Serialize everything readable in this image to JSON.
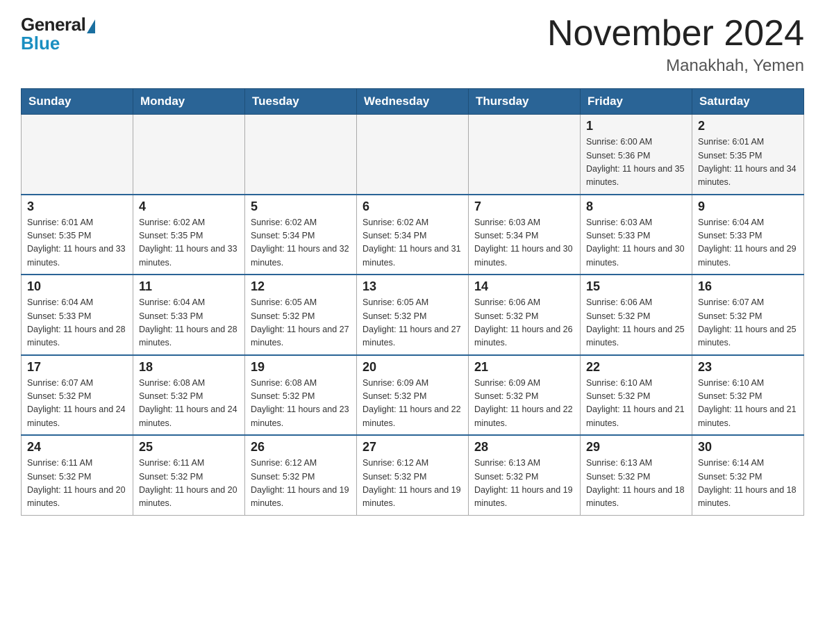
{
  "header": {
    "logo": {
      "general": "General",
      "blue": "Blue"
    },
    "title": "November 2024",
    "subtitle": "Manakhah, Yemen"
  },
  "weekdays": [
    "Sunday",
    "Monday",
    "Tuesday",
    "Wednesday",
    "Thursday",
    "Friday",
    "Saturday"
  ],
  "weeks": [
    [
      {
        "day": "",
        "sunrise": "",
        "sunset": "",
        "daylight": ""
      },
      {
        "day": "",
        "sunrise": "",
        "sunset": "",
        "daylight": ""
      },
      {
        "day": "",
        "sunrise": "",
        "sunset": "",
        "daylight": ""
      },
      {
        "day": "",
        "sunrise": "",
        "sunset": "",
        "daylight": ""
      },
      {
        "day": "",
        "sunrise": "",
        "sunset": "",
        "daylight": ""
      },
      {
        "day": "1",
        "sunrise": "Sunrise: 6:00 AM",
        "sunset": "Sunset: 5:36 PM",
        "daylight": "Daylight: 11 hours and 35 minutes."
      },
      {
        "day": "2",
        "sunrise": "Sunrise: 6:01 AM",
        "sunset": "Sunset: 5:35 PM",
        "daylight": "Daylight: 11 hours and 34 minutes."
      }
    ],
    [
      {
        "day": "3",
        "sunrise": "Sunrise: 6:01 AM",
        "sunset": "Sunset: 5:35 PM",
        "daylight": "Daylight: 11 hours and 33 minutes."
      },
      {
        "day": "4",
        "sunrise": "Sunrise: 6:02 AM",
        "sunset": "Sunset: 5:35 PM",
        "daylight": "Daylight: 11 hours and 33 minutes."
      },
      {
        "day": "5",
        "sunrise": "Sunrise: 6:02 AM",
        "sunset": "Sunset: 5:34 PM",
        "daylight": "Daylight: 11 hours and 32 minutes."
      },
      {
        "day": "6",
        "sunrise": "Sunrise: 6:02 AM",
        "sunset": "Sunset: 5:34 PM",
        "daylight": "Daylight: 11 hours and 31 minutes."
      },
      {
        "day": "7",
        "sunrise": "Sunrise: 6:03 AM",
        "sunset": "Sunset: 5:34 PM",
        "daylight": "Daylight: 11 hours and 30 minutes."
      },
      {
        "day": "8",
        "sunrise": "Sunrise: 6:03 AM",
        "sunset": "Sunset: 5:33 PM",
        "daylight": "Daylight: 11 hours and 30 minutes."
      },
      {
        "day": "9",
        "sunrise": "Sunrise: 6:04 AM",
        "sunset": "Sunset: 5:33 PM",
        "daylight": "Daylight: 11 hours and 29 minutes."
      }
    ],
    [
      {
        "day": "10",
        "sunrise": "Sunrise: 6:04 AM",
        "sunset": "Sunset: 5:33 PM",
        "daylight": "Daylight: 11 hours and 28 minutes."
      },
      {
        "day": "11",
        "sunrise": "Sunrise: 6:04 AM",
        "sunset": "Sunset: 5:33 PM",
        "daylight": "Daylight: 11 hours and 28 minutes."
      },
      {
        "day": "12",
        "sunrise": "Sunrise: 6:05 AM",
        "sunset": "Sunset: 5:32 PM",
        "daylight": "Daylight: 11 hours and 27 minutes."
      },
      {
        "day": "13",
        "sunrise": "Sunrise: 6:05 AM",
        "sunset": "Sunset: 5:32 PM",
        "daylight": "Daylight: 11 hours and 27 minutes."
      },
      {
        "day": "14",
        "sunrise": "Sunrise: 6:06 AM",
        "sunset": "Sunset: 5:32 PM",
        "daylight": "Daylight: 11 hours and 26 minutes."
      },
      {
        "day": "15",
        "sunrise": "Sunrise: 6:06 AM",
        "sunset": "Sunset: 5:32 PM",
        "daylight": "Daylight: 11 hours and 25 minutes."
      },
      {
        "day": "16",
        "sunrise": "Sunrise: 6:07 AM",
        "sunset": "Sunset: 5:32 PM",
        "daylight": "Daylight: 11 hours and 25 minutes."
      }
    ],
    [
      {
        "day": "17",
        "sunrise": "Sunrise: 6:07 AM",
        "sunset": "Sunset: 5:32 PM",
        "daylight": "Daylight: 11 hours and 24 minutes."
      },
      {
        "day": "18",
        "sunrise": "Sunrise: 6:08 AM",
        "sunset": "Sunset: 5:32 PM",
        "daylight": "Daylight: 11 hours and 24 minutes."
      },
      {
        "day": "19",
        "sunrise": "Sunrise: 6:08 AM",
        "sunset": "Sunset: 5:32 PM",
        "daylight": "Daylight: 11 hours and 23 minutes."
      },
      {
        "day": "20",
        "sunrise": "Sunrise: 6:09 AM",
        "sunset": "Sunset: 5:32 PM",
        "daylight": "Daylight: 11 hours and 22 minutes."
      },
      {
        "day": "21",
        "sunrise": "Sunrise: 6:09 AM",
        "sunset": "Sunset: 5:32 PM",
        "daylight": "Daylight: 11 hours and 22 minutes."
      },
      {
        "day": "22",
        "sunrise": "Sunrise: 6:10 AM",
        "sunset": "Sunset: 5:32 PM",
        "daylight": "Daylight: 11 hours and 21 minutes."
      },
      {
        "day": "23",
        "sunrise": "Sunrise: 6:10 AM",
        "sunset": "Sunset: 5:32 PM",
        "daylight": "Daylight: 11 hours and 21 minutes."
      }
    ],
    [
      {
        "day": "24",
        "sunrise": "Sunrise: 6:11 AM",
        "sunset": "Sunset: 5:32 PM",
        "daylight": "Daylight: 11 hours and 20 minutes."
      },
      {
        "day": "25",
        "sunrise": "Sunrise: 6:11 AM",
        "sunset": "Sunset: 5:32 PM",
        "daylight": "Daylight: 11 hours and 20 minutes."
      },
      {
        "day": "26",
        "sunrise": "Sunrise: 6:12 AM",
        "sunset": "Sunset: 5:32 PM",
        "daylight": "Daylight: 11 hours and 19 minutes."
      },
      {
        "day": "27",
        "sunrise": "Sunrise: 6:12 AM",
        "sunset": "Sunset: 5:32 PM",
        "daylight": "Daylight: 11 hours and 19 minutes."
      },
      {
        "day": "28",
        "sunrise": "Sunrise: 6:13 AM",
        "sunset": "Sunset: 5:32 PM",
        "daylight": "Daylight: 11 hours and 19 minutes."
      },
      {
        "day": "29",
        "sunrise": "Sunrise: 6:13 AM",
        "sunset": "Sunset: 5:32 PM",
        "daylight": "Daylight: 11 hours and 18 minutes."
      },
      {
        "day": "30",
        "sunrise": "Sunrise: 6:14 AM",
        "sunset": "Sunset: 5:32 PM",
        "daylight": "Daylight: 11 hours and 18 minutes."
      }
    ]
  ]
}
